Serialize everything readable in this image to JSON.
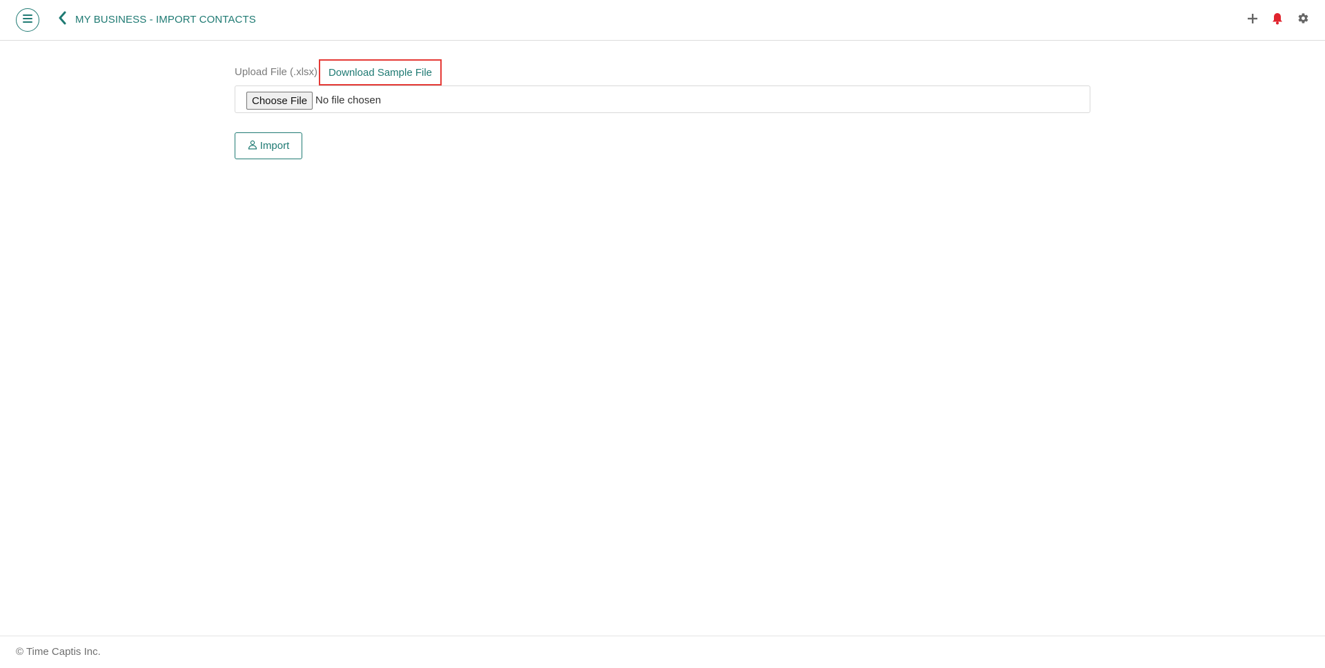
{
  "header": {
    "title": "MY BUSINESS - IMPORT CONTACTS",
    "icons": {
      "menu": "hamburger-menu-icon",
      "back": "chevron-left-icon",
      "add": "plus-icon",
      "notifications": "bell-icon",
      "settings": "gear-icon"
    }
  },
  "upload": {
    "label": "Upload File (.xlsx)",
    "download_link": "Download Sample File",
    "choose_button": "Choose File",
    "file_status": "No file chosen"
  },
  "actions": {
    "import_label": "Import",
    "import_icon": "upload-user-icon"
  },
  "footer": {
    "copyright": "© Time Captis Inc."
  },
  "colors": {
    "accent": "#1f7a73",
    "alert": "#e0242e",
    "highlight_border": "#e53935"
  }
}
